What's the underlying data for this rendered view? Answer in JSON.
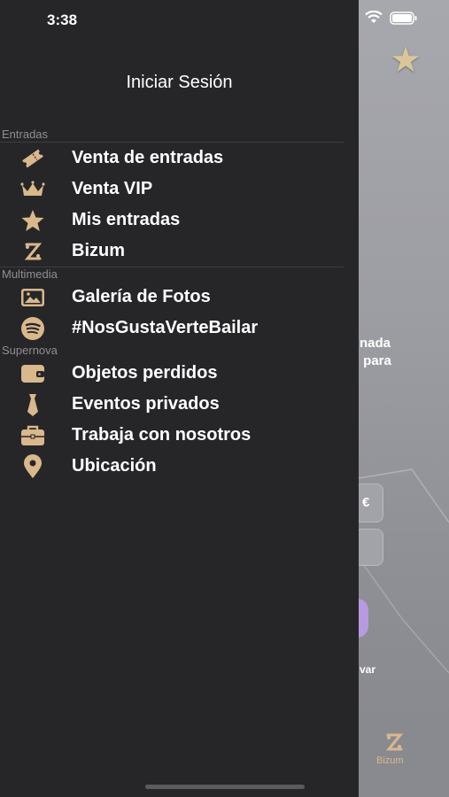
{
  "status_bar": {
    "time": "3:38"
  },
  "drawer": {
    "login_label": "Iniciar Sesión",
    "sections": {
      "entradas": "Entradas",
      "multimedia": "Multimedia",
      "supernova": "Supernova"
    },
    "items": {
      "venta_entradas": {
        "label": "Venta de entradas",
        "icon": "ticket-icon"
      },
      "venta_vip": {
        "label": "Venta VIP",
        "icon": "crown-icon"
      },
      "mis_entradas": {
        "label": "Mis entradas",
        "icon": "star-icon"
      },
      "bizum": {
        "label": "Bizum",
        "icon": "bizum-icon"
      },
      "galeria": {
        "label": "Galería de Fotos",
        "icon": "image-icon"
      },
      "spotify": {
        "label": "#NosGustaVerteBailar",
        "icon": "spotify-icon"
      },
      "objetos": {
        "label": "Objetos perdidos",
        "icon": "wallet-icon"
      },
      "eventos": {
        "label": "Eventos privados",
        "icon": "tie-icon"
      },
      "trabaja": {
        "label": "Trabaja con nosotros",
        "icon": "briefcase-icon"
      },
      "ubicacion": {
        "label": "Ubicación",
        "icon": "location-pin-icon"
      }
    }
  },
  "background_app": {
    "text": "nada\n para",
    "currency": "€",
    "small_text": "var",
    "tab_label": "Bizum"
  },
  "colors": {
    "accent": "#d9b88c",
    "drawer_bg": "#262628"
  }
}
